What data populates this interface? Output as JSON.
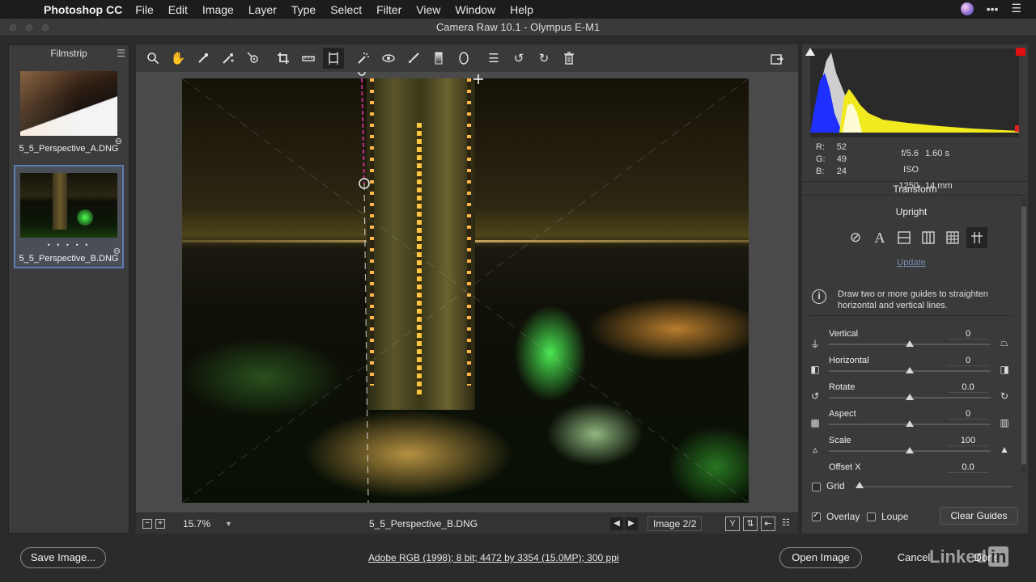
{
  "menubar": {
    "app": "Photoshop CC",
    "menus": [
      "File",
      "Edit",
      "Image",
      "Layer",
      "Type",
      "Select",
      "Filter",
      "View",
      "Window",
      "Help"
    ]
  },
  "window": {
    "title": "Camera Raw 10.1  -  Olympus E-M1"
  },
  "filmstrip": {
    "title": "Filmstrip",
    "items": [
      {
        "name": "5_5_Perspective_A.DNG",
        "selected": false
      },
      {
        "name": "5_5_Perspective_B.DNG",
        "selected": true,
        "rating_dots": "• • • • •"
      }
    ]
  },
  "toolbar": {
    "tools": [
      "zoom-tool-icon",
      "hand-tool-icon",
      "white-balance-icon",
      "color-sampler-icon",
      "targeted-adjustment-icon",
      "crop-icon",
      "straighten-icon",
      "transform-icon",
      "spot-removal-icon",
      "red-eye-icon",
      "adjustment-brush-icon",
      "graduated-filter-icon",
      "radial-filter-icon",
      "presets-list-icon",
      "rotate-left-icon",
      "rotate-right-icon",
      "trash-icon"
    ],
    "active_tool": "transform-icon"
  },
  "canvas_bar": {
    "zoom": "15.7%",
    "filename": "5_5_Perspective_B.DNG",
    "image_count": "Image 2/2"
  },
  "readout": {
    "r_label": "R:",
    "r": "52",
    "g_label": "G:",
    "g": "49",
    "b_label": "B:",
    "b": "24",
    "aperture": "f/5.6",
    "shutter": "1.60 s",
    "iso": "ISO 1250",
    "focal": "14 mm"
  },
  "transform": {
    "title": "Transform",
    "upright": "Upright",
    "update": "Update",
    "info": "Draw two or more guides to straighten horizontal and vertical lines.",
    "sliders": [
      {
        "label": "Vertical",
        "value": "0",
        "pos": 0.5
      },
      {
        "label": "Horizontal",
        "value": "0",
        "pos": 0.5
      },
      {
        "label": "Rotate",
        "value": "0.0",
        "pos": 0.5
      },
      {
        "label": "Aspect",
        "value": "0",
        "pos": 0.5
      },
      {
        "label": "Scale",
        "value": "100",
        "pos": 0.5
      },
      {
        "label": "Offset X",
        "value": "0.0",
        "pos": 0.5
      }
    ]
  },
  "options": {
    "grid": "Grid",
    "grid_checked": false,
    "overlay": "Overlay",
    "overlay_checked": true,
    "loupe": "Loupe",
    "loupe_checked": false,
    "clear_guides": "Clear Guides"
  },
  "footer": {
    "save": "Save Image...",
    "workflow": "Adobe RGB (1998); 8 bit; 4472 by 3354 (15.0MP); 300 ppi",
    "open": "Open Image",
    "cancel": "Cancel",
    "done": "Done",
    "brand": "Linked",
    "brand_box": "in"
  },
  "colors": {
    "selection": "#5c7bb5",
    "guide": "#c02e8a"
  }
}
